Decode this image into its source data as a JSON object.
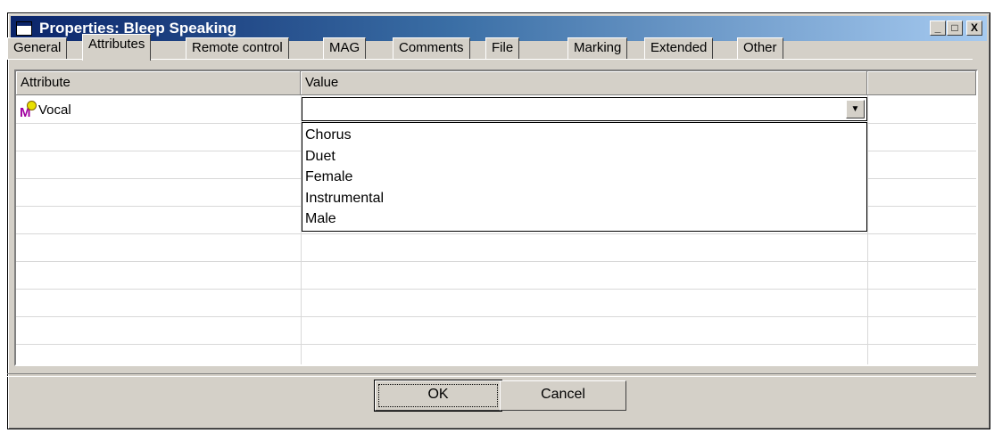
{
  "window": {
    "title": "Properties: Bleep Speaking",
    "caption_buttons": {
      "minimize": "_",
      "maximize": "□",
      "close": "X"
    }
  },
  "tabs": [
    {
      "label": "General",
      "active": false
    },
    {
      "label": "Attributes",
      "active": true
    },
    {
      "label": "Remote control",
      "active": false
    },
    {
      "label": "MAG",
      "active": false
    },
    {
      "label": "Comments",
      "active": false
    },
    {
      "label": "File",
      "active": false
    },
    {
      "label": "Marking",
      "active": false
    },
    {
      "label": "Extended",
      "active": false
    },
    {
      "label": "Other",
      "active": false
    }
  ],
  "grid": {
    "columns": [
      "Attribute",
      "Value",
      ""
    ],
    "rows": [
      {
        "attribute": "Vocal",
        "icon": "m-attribute-icon",
        "value": ""
      }
    ],
    "dropdown_options": [
      "Chorus",
      "Duet",
      "Female",
      "Instrumental",
      "Male"
    ]
  },
  "buttons": {
    "ok": "OK",
    "cancel": "Cancel"
  },
  "colors": {
    "titlebar_start": "#0a246a",
    "titlebar_end": "#a6caf0",
    "face": "#d4d0c8"
  }
}
